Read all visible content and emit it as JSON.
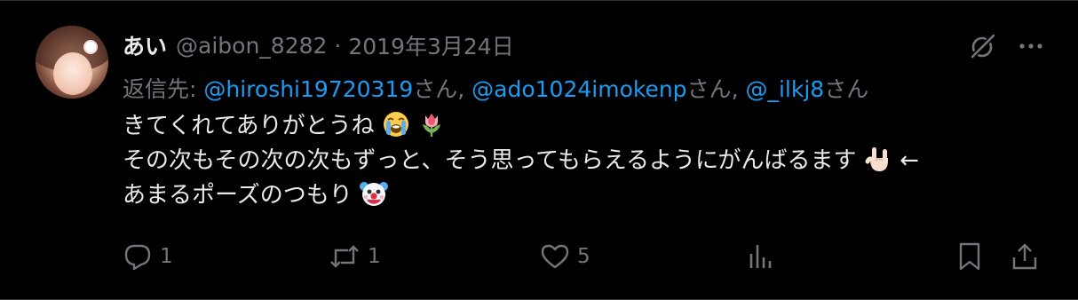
{
  "tweet": {
    "display_name": "あい",
    "handle": "@aibon_8282",
    "separator": "·",
    "date": "2019年3月24日",
    "reply_prefix": "返信先: ",
    "mentions": [
      {
        "handle": "@hiroshi19720319",
        "suffix": "さん, "
      },
      {
        "handle": "@ado1024imokenp",
        "suffix": "さん, "
      },
      {
        "handle": "@_ilkj8",
        "suffix": "さん"
      }
    ],
    "body_lines": [
      "きてくれてありがとうね",
      "その次もその次の次もずっと、そう思ってもらえるようにがんばるます",
      "あまるポーズのつもり"
    ],
    "body_arrow": "←",
    "emojis": {
      "line1": [
        "loudly-crying-face-emoji",
        "tulip-emoji"
      ],
      "line2": [
        "sign-of-the-horns-emoji"
      ],
      "line3": [
        "clown-face-emoji"
      ]
    }
  },
  "actions": {
    "reply_count": "1",
    "retweet_count": "1",
    "like_count": "5",
    "views_count": "",
    "icons": [
      "reply-icon",
      "retweet-icon",
      "like-icon",
      "views-icon",
      "bookmark-icon",
      "share-icon"
    ]
  },
  "top_icons": [
    "grok-icon",
    "more-icon"
  ],
  "colors": {
    "background": "#000000",
    "text": "#e7e9ea",
    "muted": "#71767b",
    "link": "#1d9bf0"
  }
}
